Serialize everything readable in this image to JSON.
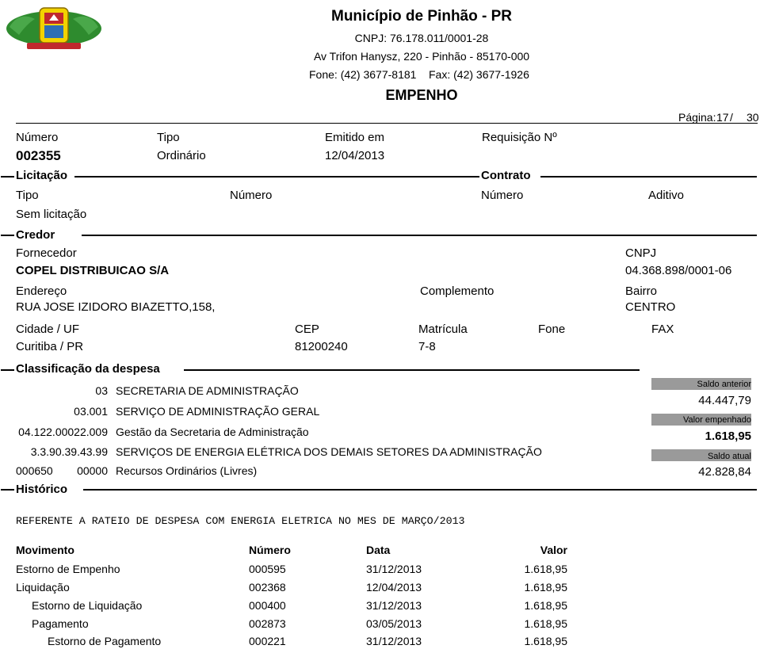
{
  "header": {
    "title": "Município de Pinhão - PR",
    "cnpj": "CNPJ: 76.178.011/0001-28",
    "address": "Av Trifon Hanysz, 220 - Pinhão - 85170-000",
    "phone": "Fone: (42) 3677-8181",
    "fax": "Fax: (42) 3677-1926",
    "doc_type": "EMPENHO",
    "page_label": "Página:",
    "page_current": "17",
    "page_sep": "/",
    "page_total": "30"
  },
  "empenho": {
    "numero_label": "Número",
    "numero": "002355",
    "tipo_label": "Tipo",
    "tipo": "Ordinário",
    "emitido_label": "Emitido em",
    "emitido": "12/04/2013",
    "requisicao_label": "Requisição Nº"
  },
  "licitacao": {
    "section": "Licitação",
    "tipo_label": "Tipo",
    "numero_label": "Número",
    "tipo": "Sem licitação"
  },
  "contrato": {
    "section": "Contrato",
    "numero_label": "Número",
    "aditivo_label": "Aditivo"
  },
  "credor": {
    "section": "Credor",
    "fornecedor_label": "Fornecedor",
    "fornecedor": "COPEL DISTRIBUICAO S/A",
    "cnpj_label": "CNPJ",
    "cnpj": "04.368.898/0001-06",
    "endereco_label": "Endereço",
    "endereco": "RUA JOSE IZIDORO BIAZETTO,158,",
    "complemento_label": "Complemento",
    "bairro_label": "Bairro",
    "bairro": "CENTRO",
    "cidade_label": "Cidade / UF",
    "cidade": "Curitiba / PR",
    "cep_label": "CEP",
    "cep": "81200240",
    "matricula_label": "Matrícula",
    "matricula": "7-8",
    "fone_label": "Fone",
    "fax_label": "FAX"
  },
  "classificacao": {
    "section": "Classificação da despesa",
    "rows": [
      {
        "code": "03",
        "desc": "SECRETARIA DE ADMINISTRAÇÃO"
      },
      {
        "code": "03.001",
        "desc": "SERVIÇO DE ADMINISTRAÇÃO GERAL"
      },
      {
        "code": "04.122.00022.009",
        "desc": "Gestão da Secretaria de Administração"
      },
      {
        "code": "3.3.90.39.43.99",
        "desc": "SERVIÇOS DE ENERGIA ELÉTRICA DOS DEMAIS SETORES DA ADMINISTRAÇÃO"
      }
    ],
    "fonte_code": "000650",
    "fonte_sub": "00000",
    "fonte_desc": "Recursos Ordinários (Livres)"
  },
  "saldos": {
    "anterior_label": "Saldo anterior",
    "anterior": "44.447,79",
    "empenhado_label": "Valor empenhado",
    "empenhado": "1.618,95",
    "atual_label": "Saldo atual",
    "atual": "42.828,84"
  },
  "historico": {
    "section": "Histórico",
    "text": "REFERENTE A RATEIO DE DESPESA COM ENERGIA ELETRICA NO MES DE MARÇO/2013"
  },
  "movimentos": {
    "headers": {
      "movimento": "Movimento",
      "numero": "Número",
      "data": "Data",
      "valor": "Valor"
    },
    "rows": [
      {
        "movimento": "Estorno de Empenho",
        "numero": "000595",
        "data": "31/12/2013",
        "valor": "1.618,95"
      },
      {
        "movimento": "Liquidação",
        "numero": "002368",
        "data": "12/04/2013",
        "valor": "1.618,95"
      },
      {
        "movimento": "Estorno de Liquidação",
        "numero": "000400",
        "data": "31/12/2013",
        "valor": "1.618,95"
      },
      {
        "movimento": "Pagamento",
        "numero": "002873",
        "data": "03/05/2013",
        "valor": "1.618,95"
      },
      {
        "movimento": "Estorno de Pagamento",
        "numero": "000221",
        "data": "31/12/2013",
        "valor": "1.618,95"
      }
    ]
  },
  "colors": {
    "logo_green": "#2e8b2e",
    "logo_yellow": "#f2d200",
    "logo_red": "#c0282d",
    "bar_gray": "#9a9a9a"
  }
}
